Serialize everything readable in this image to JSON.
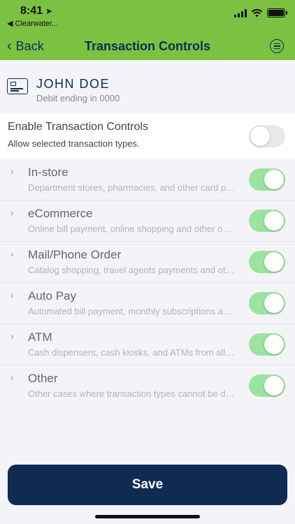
{
  "status_bar": {
    "time": "8:41",
    "location_icon": "location-arrow-icon",
    "back_app": "◀ Clearwater..."
  },
  "nav": {
    "back_label": "Back",
    "title": "Transaction Controls",
    "menu_icon": "menu-icon"
  },
  "card": {
    "name": "JOHN DOE",
    "subtitle": "Debit ending in 0000",
    "icon": "card-icon"
  },
  "enable": {
    "title": "Enable Transaction Controls",
    "subtitle": "Allow selected transaction types.",
    "toggle_on": false
  },
  "transaction_types": [
    {
      "title": "In-store",
      "description": "Department stores, pharmacies, and other card present transactions",
      "enabled": true
    },
    {
      "title": "eCommerce",
      "description": "Online bill payment, online shopping and other online purchases",
      "enabled": true
    },
    {
      "title": "Mail/Phone Order",
      "description": "Catalog shopping, travel agents payments and other mail or phone orders",
      "enabled": true
    },
    {
      "title": "Auto Pay",
      "description": "Automated bill payment, monthly subscriptions and recurring payments",
      "enabled": true
    },
    {
      "title": "ATM",
      "description": "Cash dispensers, cash kiosks, and ATMs from all banks",
      "enabled": true
    },
    {
      "title": "Other",
      "description": "Other cases where transaction types cannot be determined",
      "enabled": true
    }
  ],
  "save_label": "Save",
  "colors": {
    "header_green": "#7cc142",
    "navy": "#0f2b52",
    "toggle_on": "#9be39e",
    "toggle_off": "#e9e9ea"
  }
}
